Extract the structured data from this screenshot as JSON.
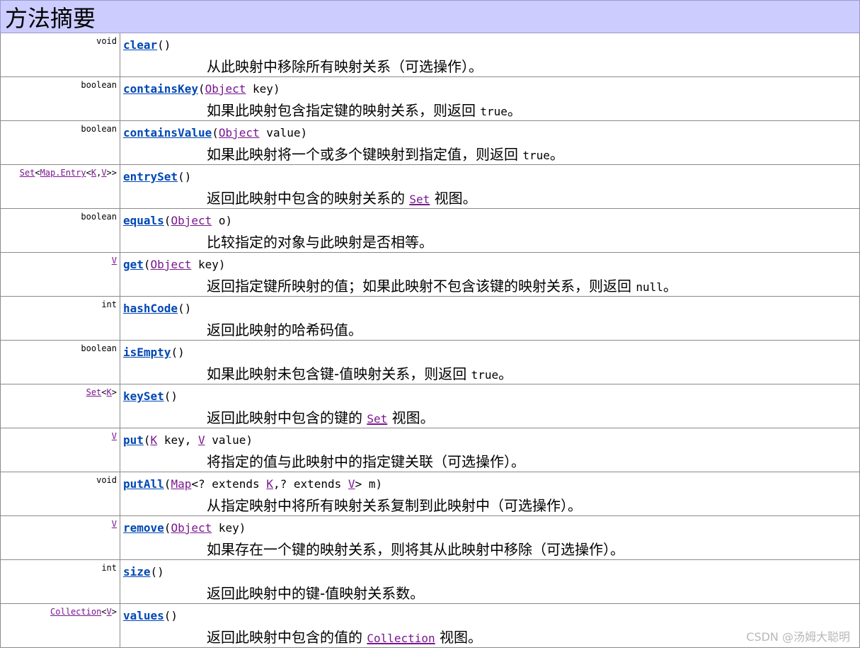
{
  "title": "方法摘要",
  "watermark": "CSDN @汤姆大聪明",
  "methods": [
    {
      "type": [
        {
          "t": "void"
        }
      ],
      "name": "clear",
      "params": [
        {
          "t": "()"
        }
      ],
      "desc": [
        {
          "t": "从此映射中移除所有映射关系（可选操作）。"
        }
      ]
    },
    {
      "type": [
        {
          "t": "boolean"
        }
      ],
      "name": "containsKey",
      "params": [
        {
          "t": "("
        },
        {
          "t": "Object",
          "link": true
        },
        {
          "t": " key)"
        }
      ],
      "desc": [
        {
          "t": "如果此映射包含指定键的映射关系，则返回 "
        },
        {
          "t": "true",
          "code": true
        },
        {
          "t": "。"
        }
      ]
    },
    {
      "type": [
        {
          "t": "boolean"
        }
      ],
      "name": "containsValue",
      "params": [
        {
          "t": "("
        },
        {
          "t": "Object",
          "link": true
        },
        {
          "t": " value)"
        }
      ],
      "desc": [
        {
          "t": "如果此映射将一个或多个键映射到指定值，则返回 "
        },
        {
          "t": "true",
          "code": true
        },
        {
          "t": "。"
        }
      ]
    },
    {
      "type": [
        {
          "t": "Set",
          "link": true
        },
        {
          "t": "<"
        },
        {
          "t": "Map.Entry",
          "link": true
        },
        {
          "t": "<"
        },
        {
          "t": "K",
          "link": true
        },
        {
          "t": ","
        },
        {
          "t": "V",
          "link": true
        },
        {
          "t": ">>"
        }
      ],
      "name": "entrySet",
      "params": [
        {
          "t": "()"
        }
      ],
      "desc": [
        {
          "t": "返回此映射中包含的映射关系的 "
        },
        {
          "t": "Set",
          "code": true,
          "link": true
        },
        {
          "t": " 视图。"
        }
      ]
    },
    {
      "type": [
        {
          "t": "boolean"
        }
      ],
      "name": "equals",
      "params": [
        {
          "t": "("
        },
        {
          "t": "Object",
          "link": true
        },
        {
          "t": " o)"
        }
      ],
      "desc": [
        {
          "t": "比较指定的对象与此映射是否相等。"
        }
      ]
    },
    {
      "type": [
        {
          "t": "V",
          "link": true
        }
      ],
      "name": "get",
      "params": [
        {
          "t": "("
        },
        {
          "t": "Object",
          "link": true
        },
        {
          "t": " key)"
        }
      ],
      "desc": [
        {
          "t": "返回指定键所映射的值；如果此映射不包含该键的映射关系，则返回 "
        },
        {
          "t": "null",
          "code": true
        },
        {
          "t": "。"
        }
      ]
    },
    {
      "type": [
        {
          "t": "int"
        }
      ],
      "name": "hashCode",
      "params": [
        {
          "t": "()"
        }
      ],
      "desc": [
        {
          "t": "返回此映射的哈希码值。"
        }
      ]
    },
    {
      "type": [
        {
          "t": "boolean"
        }
      ],
      "name": "isEmpty",
      "params": [
        {
          "t": "()"
        }
      ],
      "desc": [
        {
          "t": "如果此映射未包含键-值映射关系，则返回 "
        },
        {
          "t": "true",
          "code": true
        },
        {
          "t": "。"
        }
      ]
    },
    {
      "type": [
        {
          "t": "Set",
          "link": true
        },
        {
          "t": "<"
        },
        {
          "t": "K",
          "link": true
        },
        {
          "t": ">"
        }
      ],
      "name": "keySet",
      "params": [
        {
          "t": "()"
        }
      ],
      "desc": [
        {
          "t": "返回此映射中包含的键的 "
        },
        {
          "t": "Set",
          "code": true,
          "link": true
        },
        {
          "t": " 视图。"
        }
      ]
    },
    {
      "type": [
        {
          "t": "V",
          "link": true
        }
      ],
      "name": "put",
      "params": [
        {
          "t": "("
        },
        {
          "t": "K",
          "link": true
        },
        {
          "t": " key, "
        },
        {
          "t": "V",
          "link": true
        },
        {
          "t": " value)"
        }
      ],
      "desc": [
        {
          "t": "将指定的值与此映射中的指定键关联（可选操作）。"
        }
      ]
    },
    {
      "type": [
        {
          "t": "void"
        }
      ],
      "name": "putAll",
      "params": [
        {
          "t": "("
        },
        {
          "t": "Map",
          "link": true
        },
        {
          "t": "<? extends "
        },
        {
          "t": "K",
          "link": true
        },
        {
          "t": ",? extends "
        },
        {
          "t": "V",
          "link": true
        },
        {
          "t": "> m)"
        }
      ],
      "desc": [
        {
          "t": "从指定映射中将所有映射关系复制到此映射中（可选操作）。"
        }
      ]
    },
    {
      "type": [
        {
          "t": "V",
          "link": true
        }
      ],
      "name": "remove",
      "params": [
        {
          "t": "("
        },
        {
          "t": "Object",
          "link": true
        },
        {
          "t": " key)"
        }
      ],
      "desc": [
        {
          "t": "如果存在一个键的映射关系，则将其从此映射中移除（可选操作）。"
        }
      ]
    },
    {
      "type": [
        {
          "t": "int"
        }
      ],
      "name": "size",
      "params": [
        {
          "t": "()"
        }
      ],
      "desc": [
        {
          "t": "返回此映射中的键-值映射关系数。"
        }
      ]
    },
    {
      "type": [
        {
          "t": "Collection",
          "link": true
        },
        {
          "t": "<"
        },
        {
          "t": "V",
          "link": true
        },
        {
          "t": ">"
        }
      ],
      "name": "values",
      "params": [
        {
          "t": "()"
        }
      ],
      "desc": [
        {
          "t": "返回此映射中包含的值的 "
        },
        {
          "t": "Collection",
          "code": true,
          "link": true
        },
        {
          "t": " 视图。"
        }
      ]
    }
  ]
}
